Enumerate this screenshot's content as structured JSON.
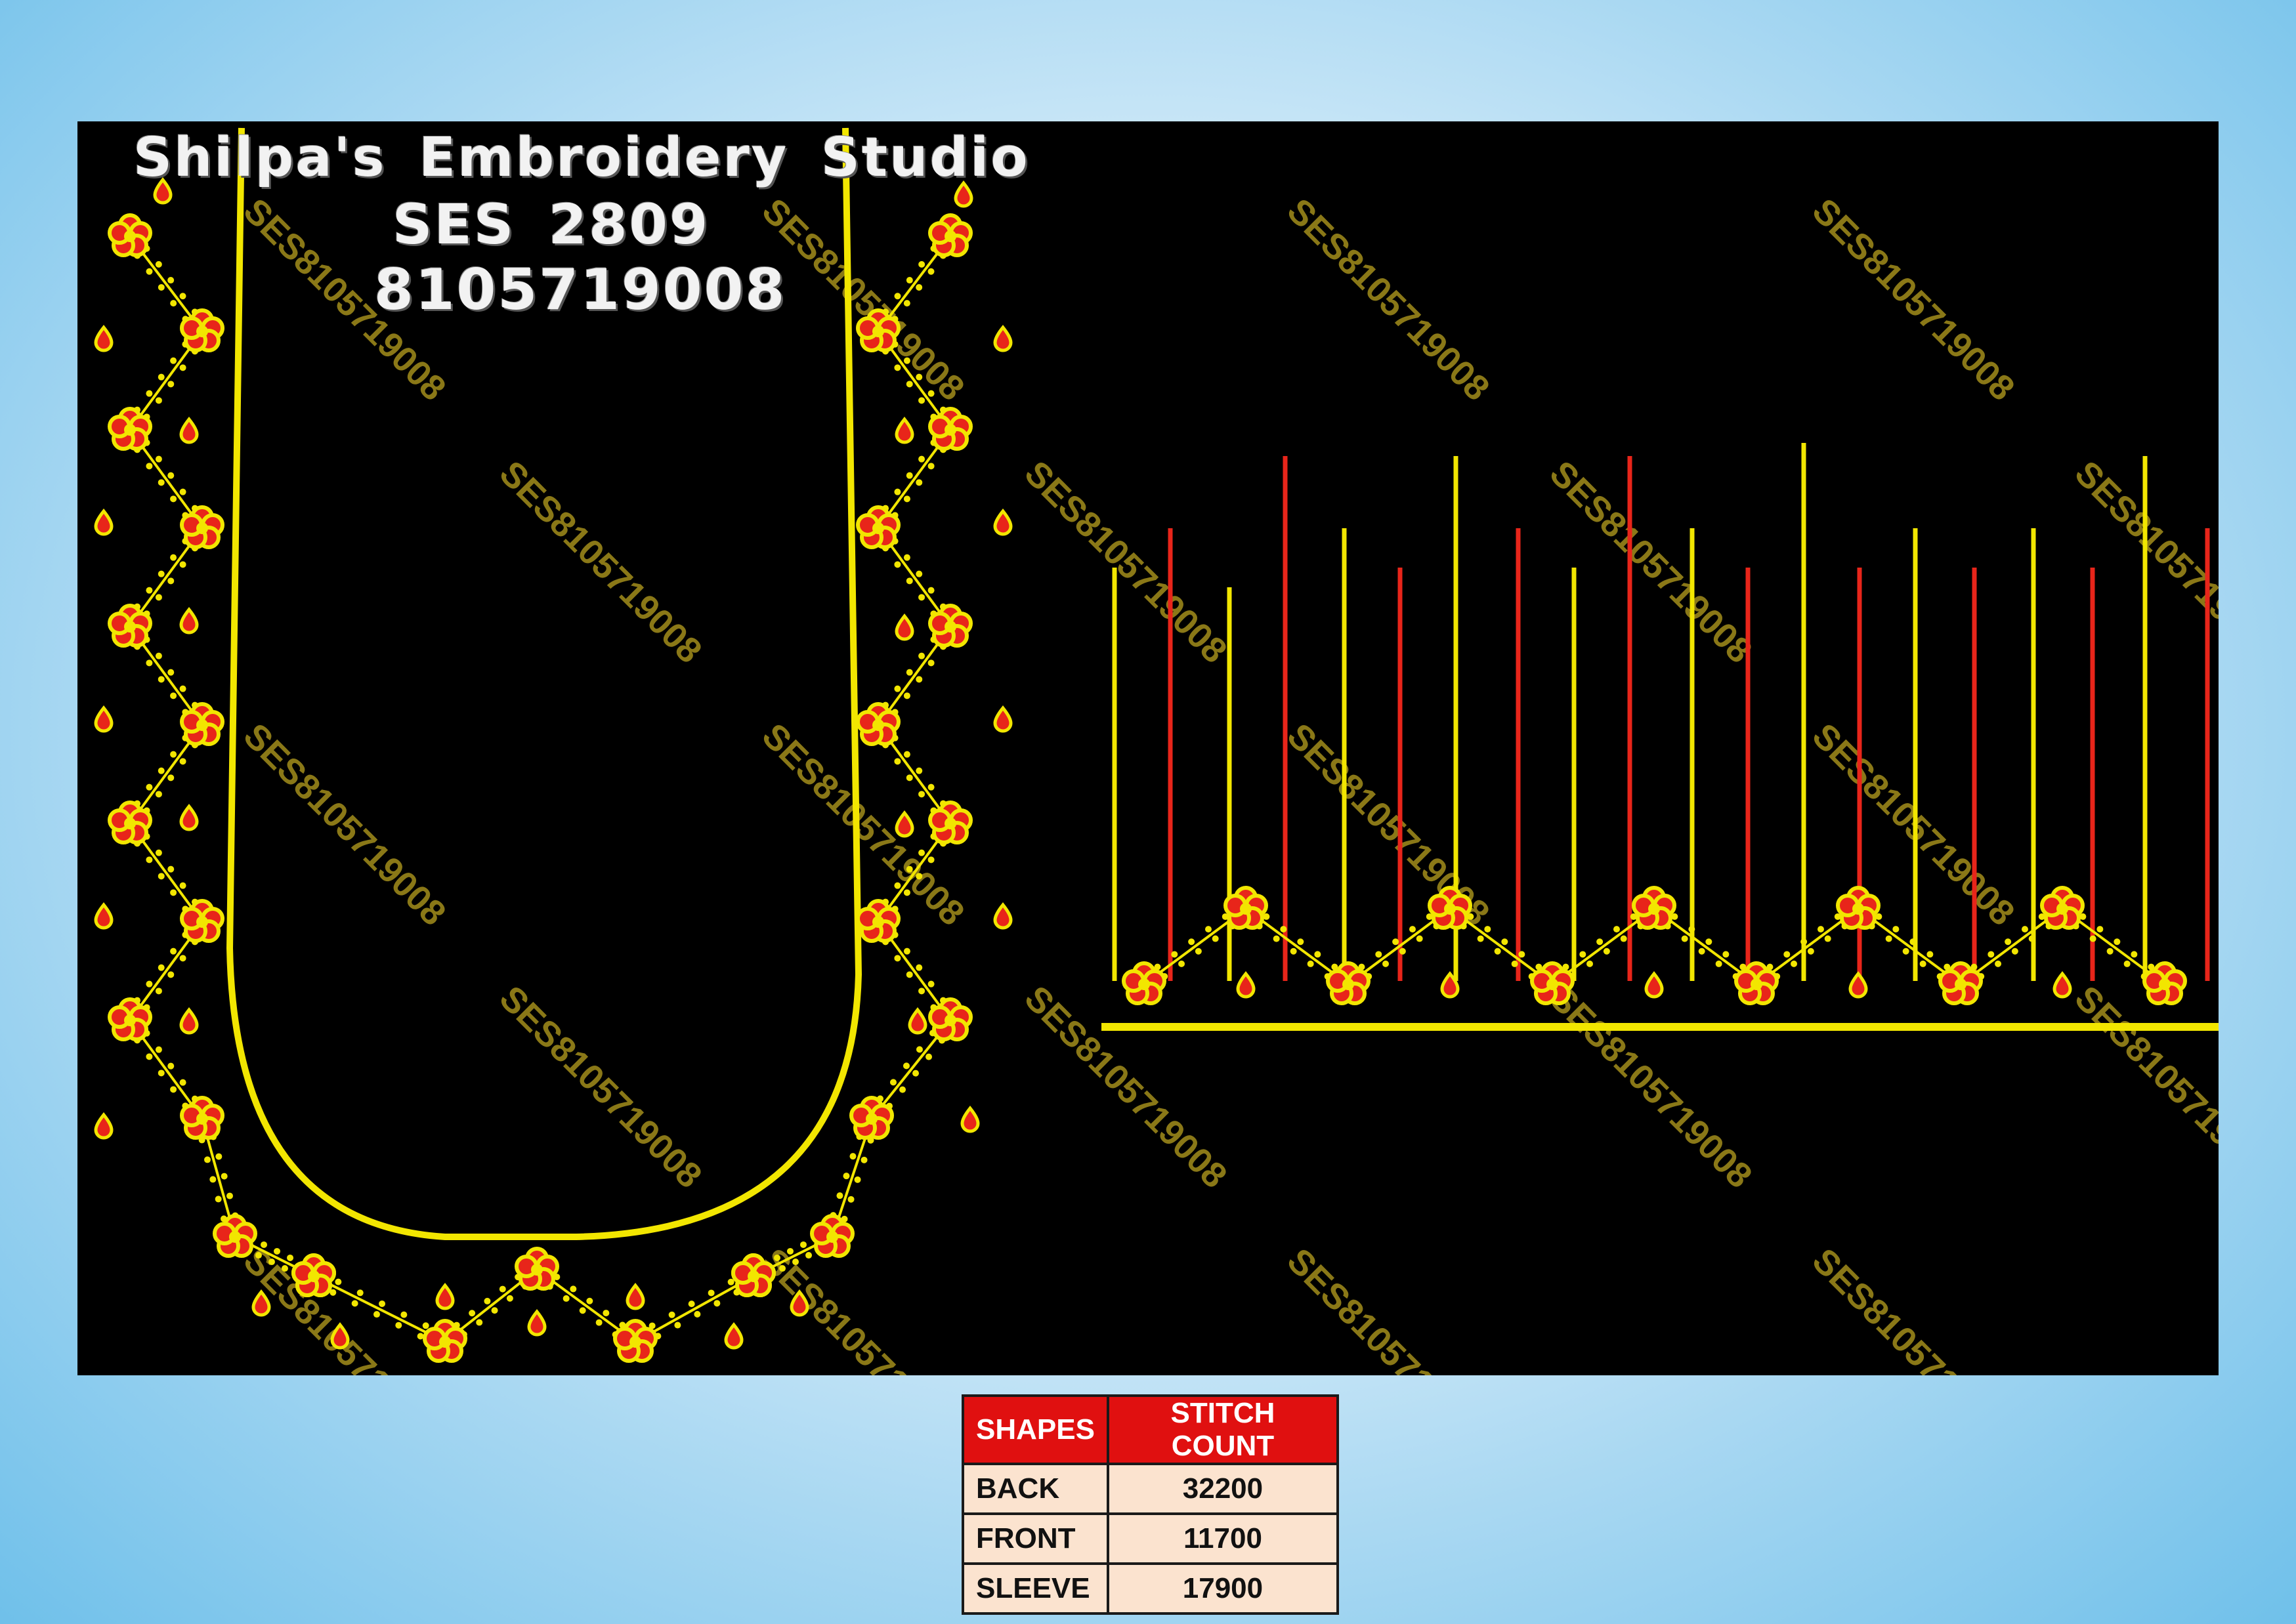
{
  "studio": {
    "name": "Shilpa's Embroidery Studio",
    "design_code": "SES 2809",
    "phone": "8105719008"
  },
  "watermark": {
    "text": "SES8105719008"
  },
  "colors": {
    "background": "#000000",
    "gold": "#f2e600",
    "red": "#e8251a",
    "table_header": "#e01010",
    "table_cell": "#fbe3cf"
  },
  "stitch_table": {
    "headers": [
      "SHAPES",
      "STITCH COUNT"
    ],
    "rows": [
      {
        "shape": "BACK",
        "count": "32200"
      },
      {
        "shape": "FRONT",
        "count": "11700"
      },
      {
        "shape": "SLEEVE",
        "count": "17900"
      }
    ]
  }
}
